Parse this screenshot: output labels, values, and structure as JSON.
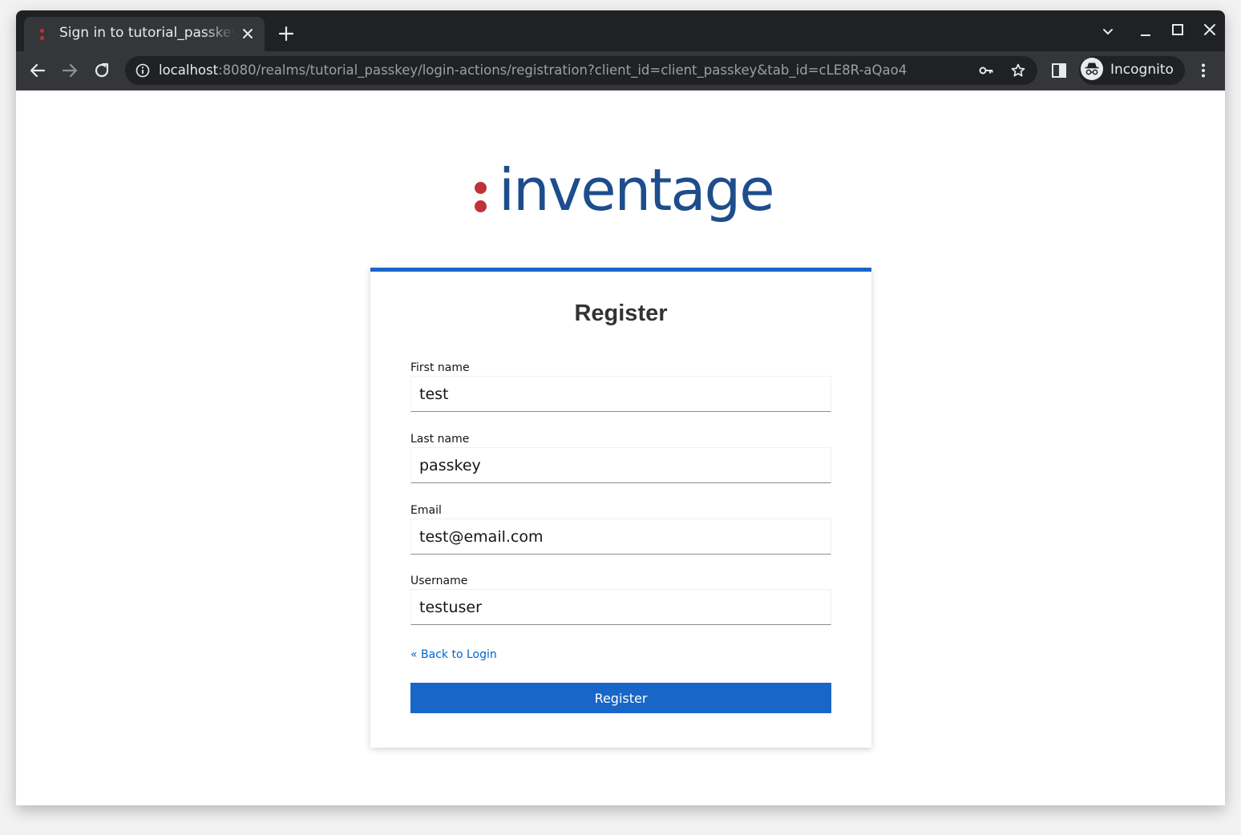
{
  "browser": {
    "tab_title": "Sign in to tutorial_passkey",
    "url_host": "localhost",
    "url_rest": ":8080/realms/tutorial_passkey/login-actions/registration?client_id=client_passkey&tab_id=cLE8R-aQao4",
    "profile_label": "Incognito"
  },
  "logo": {
    "text": "inventage"
  },
  "form": {
    "title": "Register",
    "fields": [
      {
        "label": "First name",
        "value": "test"
      },
      {
        "label": "Last name",
        "value": "passkey"
      },
      {
        "label": "Email",
        "value": "test@email.com"
      },
      {
        "label": "Username",
        "value": "testuser"
      }
    ],
    "back_link": "« Back to Login",
    "submit_label": "Register"
  },
  "colors": {
    "accent": "#1866c8",
    "logo_blue": "#1d4d8c",
    "logo_red": "#c0313a"
  }
}
